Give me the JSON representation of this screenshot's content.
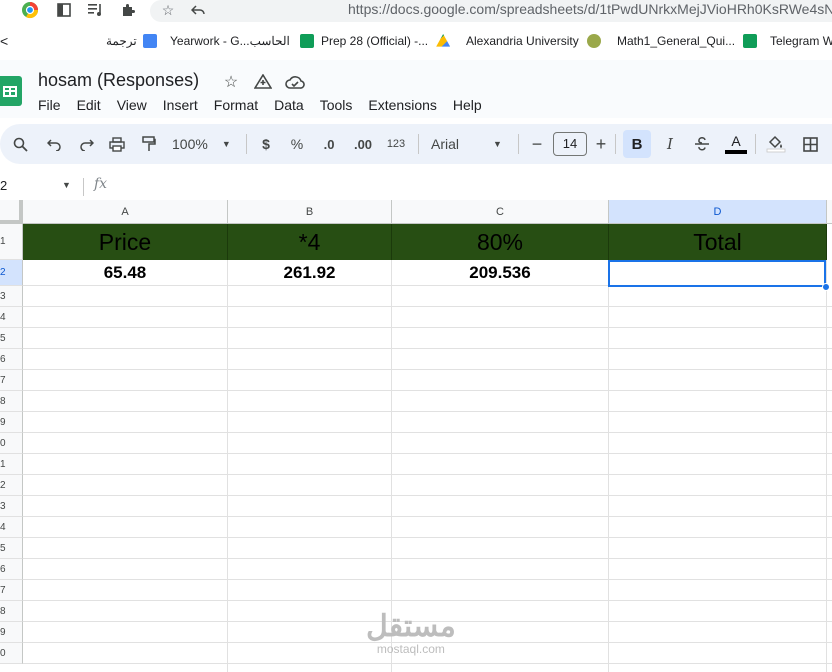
{
  "browser": {
    "url": "https://docs.google.com/spreadsheets/d/1tPwdUNrkxMejJVioHRh0KsRWe4sN",
    "back_label": "<"
  },
  "bookmarks": [
    {
      "label": "ترجمة",
      "color": "#4285f4"
    },
    {
      "label": "Yearwork - G...الحاسب",
      "color": "#0f9d58"
    },
    {
      "label": "Prep 28 (Official) -...",
      "color": "#fbbc04"
    },
    {
      "label": "Alexandria University",
      "color": "#9aa84a"
    },
    {
      "label": "Math1_General_Qui...",
      "color": "#0f9d58"
    },
    {
      "label": "Telegram W",
      "color": "#0f9d58"
    }
  ],
  "doc": {
    "title": "hosam  (Responses)",
    "menu": [
      "File",
      "Edit",
      "View",
      "Insert",
      "Format",
      "Data",
      "Tools",
      "Extensions",
      "Help"
    ]
  },
  "toolbar": {
    "zoom": "100%",
    "currency": "$",
    "percent": "%",
    "dec_decrease": ".0",
    "dec_increase": ".00",
    "format_123": "123",
    "font": "Arial",
    "font_size": "14",
    "minus": "−",
    "plus": "+",
    "bold": "B",
    "italic": "I",
    "text_color": "A"
  },
  "formula_bar": {
    "name_box": "2",
    "fx": "fx"
  },
  "sheet": {
    "columns": [
      "A",
      "B",
      "C",
      "D"
    ],
    "rows": [
      "1",
      "2",
      "3",
      "4",
      "5",
      "6",
      "7",
      "8",
      "9",
      "0",
      "1",
      "2",
      "3",
      "4",
      "5",
      "6",
      "7",
      "8",
      "9",
      "0"
    ],
    "header_row": [
      "Price",
      "*4",
      "80%",
      "Total"
    ],
    "data_row": [
      "65.48",
      "261.92",
      "209.536",
      ""
    ],
    "header_fill": "#274e13",
    "selected_cell": "D2"
  },
  "watermark": {
    "arabic": "مستقل",
    "latin": "mostaql.com"
  }
}
